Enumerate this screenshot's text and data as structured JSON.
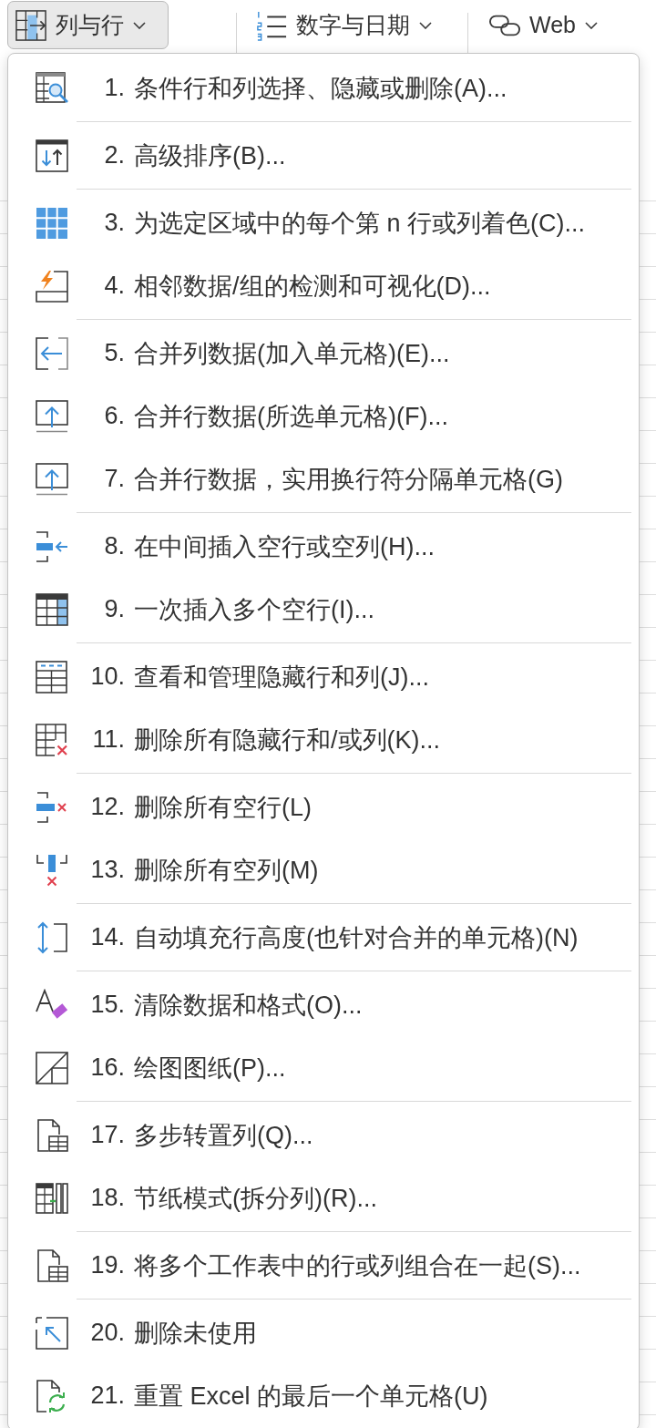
{
  "toolbar": {
    "buttons": [
      {
        "label": "列与行",
        "selected": true
      },
      {
        "label": "数字与日期",
        "selected": false
      },
      {
        "label": "Web",
        "selected": false
      }
    ]
  },
  "menu": {
    "groups": [
      {
        "items": [
          {
            "number": "1.",
            "label": "条件行和列选择、隐藏或删除(A)..."
          }
        ]
      },
      {
        "items": [
          {
            "number": "2.",
            "label": "高级排序(B)..."
          }
        ]
      },
      {
        "items": [
          {
            "number": "3.",
            "label": "为选定区域中的每个第 n 行或列着色(C)..."
          },
          {
            "number": "4.",
            "label": "相邻数据/组的检测和可视化(D)..."
          }
        ]
      },
      {
        "items": [
          {
            "number": "5.",
            "label": "合并列数据(加入单元格)(E)..."
          },
          {
            "number": "6.",
            "label": "合并行数据(所选单元格)(F)..."
          },
          {
            "number": "7.",
            "label": "合并行数据，实用换行符分隔单元格(G)"
          }
        ]
      },
      {
        "items": [
          {
            "number": "8.",
            "label": "在中间插入空行或空列(H)..."
          },
          {
            "number": "9.",
            "label": "一次插入多个空行(I)..."
          }
        ]
      },
      {
        "items": [
          {
            "number": "10.",
            "label": "查看和管理隐藏行和列(J)..."
          },
          {
            "number": "11.",
            "label": "删除所有隐藏行和/或列(K)..."
          }
        ]
      },
      {
        "items": [
          {
            "number": "12.",
            "label": "删除所有空行(L)"
          },
          {
            "number": "13.",
            "label": "删除所有空列(M)"
          }
        ]
      },
      {
        "items": [
          {
            "number": "14.",
            "label": "自动填充行高度(也针对合并的单元格)(N)"
          }
        ]
      },
      {
        "items": [
          {
            "number": "15.",
            "label": "清除数据和格式(O)..."
          },
          {
            "number": "16.",
            "label": "绘图图纸(P)..."
          }
        ]
      },
      {
        "items": [
          {
            "number": "17.",
            "label": "多步转置列(Q)..."
          },
          {
            "number": "18.",
            "label": "节纸模式(拆分列)(R)..."
          }
        ]
      },
      {
        "items": [
          {
            "number": "19.",
            "label": "将多个工作表中的行或列组合在一起(S)..."
          }
        ]
      },
      {
        "items": [
          {
            "number": "20.",
            "label": "删除未使用"
          },
          {
            "number": "21.",
            "label": "重置 Excel 的最后一个单元格(U)"
          }
        ]
      }
    ]
  }
}
